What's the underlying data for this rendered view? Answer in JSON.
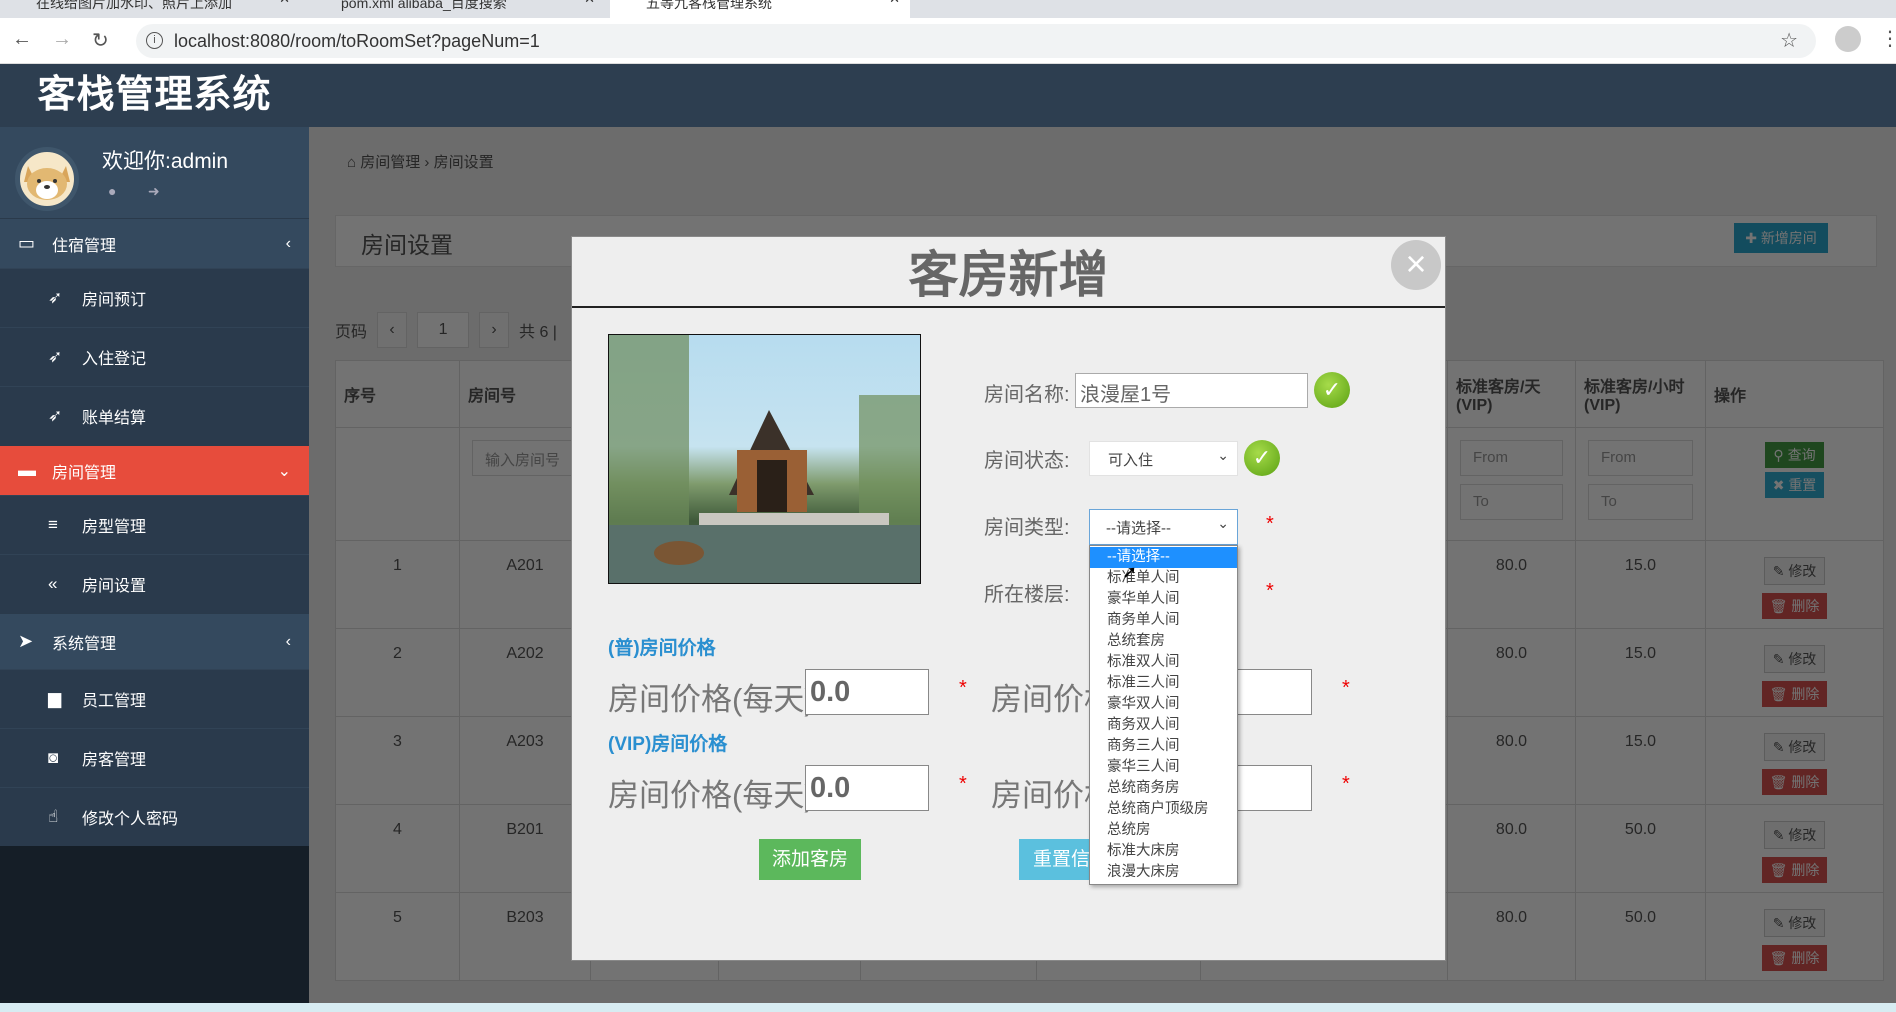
{
  "browser": {
    "tabs": [
      "在线给图片加水印、照片上添加",
      "pom.xml alibaba_百度搜索",
      "五等九客栈管理系统"
    ],
    "url": "localhost:8080/room/toRoomSet?pageNum=1"
  },
  "sidebar": {
    "brand": "客栈管理系统",
    "welcome": "欢迎你:admin",
    "menus": [
      {
        "label": "住宿管理",
        "items": [
          "房间预订",
          "入住登记",
          "账单结算"
        ]
      },
      {
        "label": "房间管理",
        "items": [
          "房型管理",
          "房间设置"
        ]
      },
      {
        "label": "系统管理",
        "items": [
          "员工管理",
          "房客管理",
          "修改个人密码"
        ]
      }
    ]
  },
  "breadcrumb": {
    "parent": "房间管理",
    "sep": "›",
    "current": "房间设置"
  },
  "page": {
    "title": "房间设置",
    "add_button": "新增房间"
  },
  "pager": {
    "label": "页码",
    "prev": "‹",
    "current": "1",
    "next": "›",
    "total": "共 6 |"
  },
  "table": {
    "headers": {
      "index": "序号",
      "room_no": "房间号",
      "vip_day": "标准客房/天 (VIP)",
      "vip_hour": "标准客房/小时 (VIP)",
      "ops": "操作"
    },
    "filters": {
      "room_no_placeholder": "输入房间号",
      "from": "From",
      "to": "To",
      "search": "查询",
      "reset": "重置"
    },
    "edit": "修改",
    "delete": "删除",
    "rows": [
      {
        "index": "1",
        "room_no": "A201",
        "vip_day": "80.0",
        "vip_hour": "15.0"
      },
      {
        "index": "2",
        "room_no": "A202",
        "vip_day": "80.0",
        "vip_hour": "15.0"
      },
      {
        "index": "3",
        "room_no": "A203",
        "vip_day": "80.0",
        "vip_hour": "15.0"
      },
      {
        "index": "4",
        "room_no": "B201",
        "vip_day": "80.0",
        "vip_hour": "50.0"
      },
      {
        "index": "5",
        "room_no": "B203",
        "vip_day": "80.0",
        "vip_hour": "50.0"
      }
    ]
  },
  "modal": {
    "title": "客房新增",
    "close": "×",
    "name_label": "房间名称:",
    "name_value": "浪漫屋1号",
    "status_label": "房间状态:",
    "status_value": "可入住",
    "type_label": "房间类型:",
    "type_value": "--请选择--",
    "floor_label": "所在楼层:",
    "required": "*",
    "normal_price_heading": "(普)房间价格",
    "vip_price_heading": "(VIP)房间价格",
    "price_day_label": "房间价格(每天):",
    "price_hour_label_partial": "房间价格",
    "normal_day_value": "0.0",
    "vip_day_value": "0.0",
    "add_button": "添加客房",
    "reset_button": "重置信息",
    "type_options": [
      "--请选择--",
      "标准单人间",
      "豪华单人间",
      "商务单人间",
      "总统套房",
      "标准双人间",
      "标准三人间",
      "豪华双人间",
      "商务双人间",
      "商务三人间",
      "豪华三人间",
      "总统商务房",
      "总统商户顶级房",
      "总统房",
      "标准大床房",
      "浪漫大床房"
    ]
  },
  "colors": {
    "sidebar": "#2d3e50",
    "active_menu": "#e74c3c",
    "add_green": "#5cb85c",
    "reset_blue": "#5bc0de",
    "heading_blue": "#2a8fd0"
  }
}
